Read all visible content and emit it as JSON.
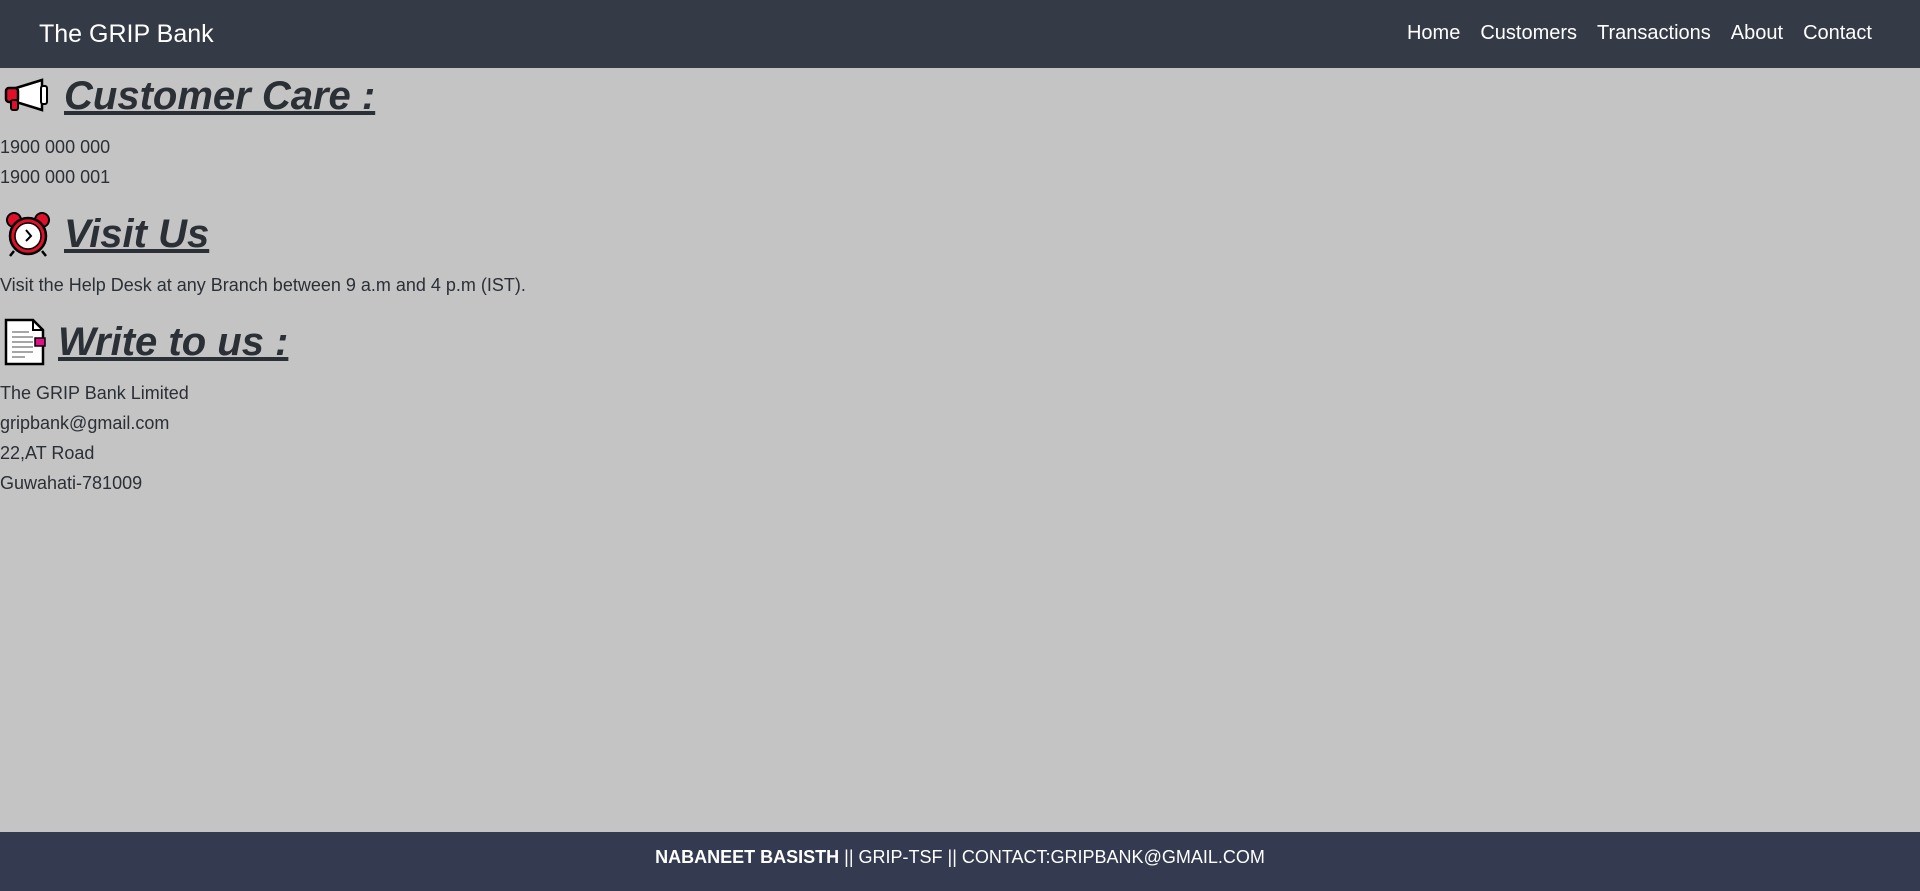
{
  "navbar": {
    "brand": "The GRIP Bank",
    "links": [
      "Home",
      "Customers",
      "Transactions",
      "About",
      "Contact"
    ]
  },
  "customer_care": {
    "title": "Customer Care :",
    "icon": "megaphone-icon",
    "lines": [
      "1900 000 000",
      "1900 000 001"
    ]
  },
  "visit_us": {
    "title": "Visit Us",
    "icon": "alarm-clock-icon",
    "text": "Visit the Help Desk at any Branch between 9 a.m and 4 p.m (IST)."
  },
  "write_to_us": {
    "title": "Write to us :",
    "icon": "document-icon",
    "lines": [
      "The GRIP Bank Limited",
      "gripbank@gmail.com",
      "22,AT Road",
      "Guwahati-781009"
    ]
  },
  "footer": {
    "name": "NABANEET BASISTH",
    "sep1": " || ",
    "tag": "GRIP-TSF",
    "sep2": " || ",
    "contact": "CONTACT:GRIPBANK@GMAIL.COM"
  },
  "colors": {
    "navbar_bg": "#343a46",
    "page_bg": "#c4c4c4",
    "footer_bg": "#343a50"
  }
}
